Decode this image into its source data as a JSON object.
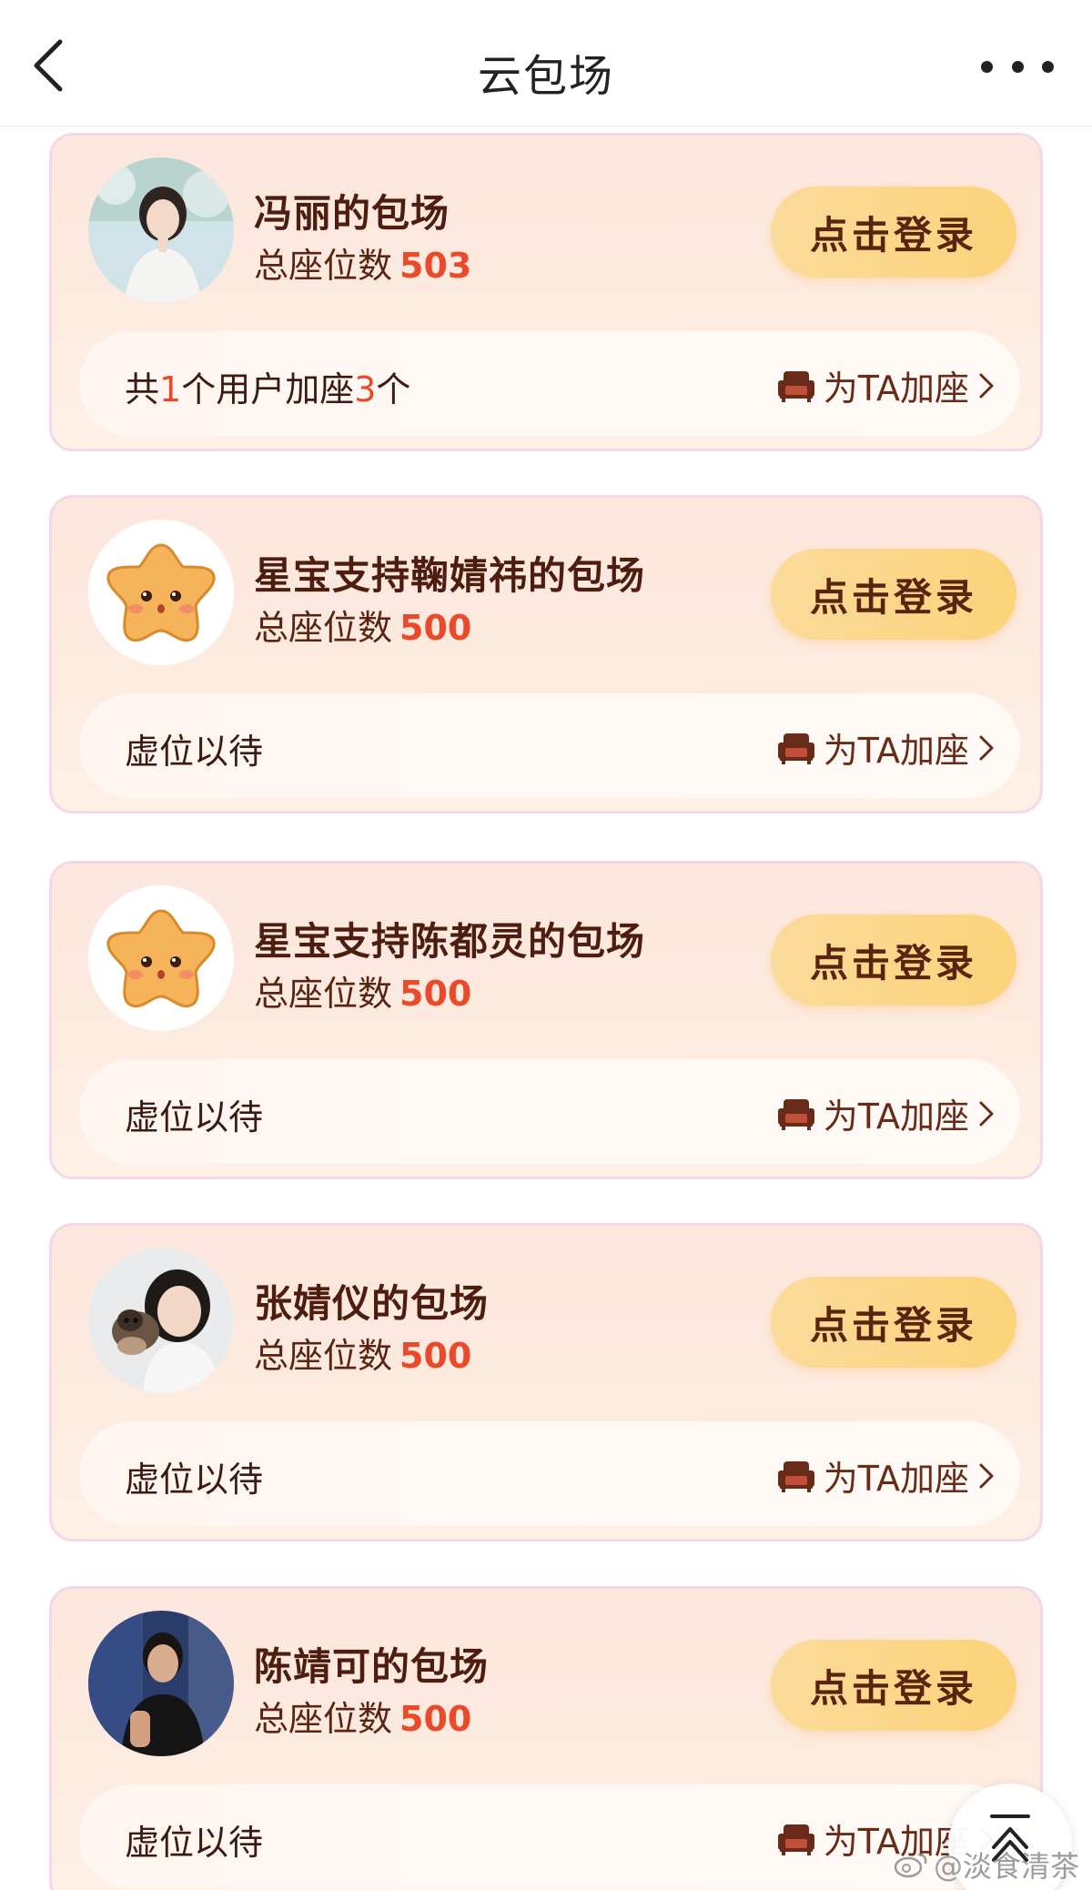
{
  "header": {
    "title": "云包场"
  },
  "cards": [
    {
      "title": "冯丽的包场",
      "seat_label": "总座位数",
      "seat_count": "503",
      "login_label": "点击登录",
      "status_parts": [
        "共",
        "1",
        "个用户加座",
        "3",
        "个"
      ],
      "add_seat_label": "为TA加座",
      "avatar_icon": "woman-photo"
    },
    {
      "title": "星宝支持鞠婧祎的包场",
      "seat_label": "总座位数",
      "seat_count": "500",
      "login_label": "点击登录",
      "status_text": "虚位以待",
      "add_seat_label": "为TA加座",
      "avatar_icon": "star-mascot"
    },
    {
      "title": "星宝支持陈都灵的包场",
      "seat_label": "总座位数",
      "seat_count": "500",
      "login_label": "点击登录",
      "status_text": "虚位以待",
      "add_seat_label": "为TA加座",
      "avatar_icon": "star-mascot"
    },
    {
      "title": "张婧仪的包场",
      "seat_label": "总座位数",
      "seat_count": "500",
      "login_label": "点击登录",
      "status_text": "虚位以待",
      "add_seat_label": "为TA加座",
      "avatar_icon": "woman-with-dog-photo"
    },
    {
      "title": "陈靖可的包场",
      "seat_label": "总座位数",
      "seat_count": "500",
      "login_label": "点击登录",
      "status_text": "虚位以待",
      "add_seat_label": "为TA加座",
      "avatar_icon": "man-photo"
    }
  ],
  "watermark": "@淡食清茶",
  "colors": {
    "accent": "#ea4a2a",
    "button": "#fcd37a",
    "card_bg": "#fde6de"
  }
}
